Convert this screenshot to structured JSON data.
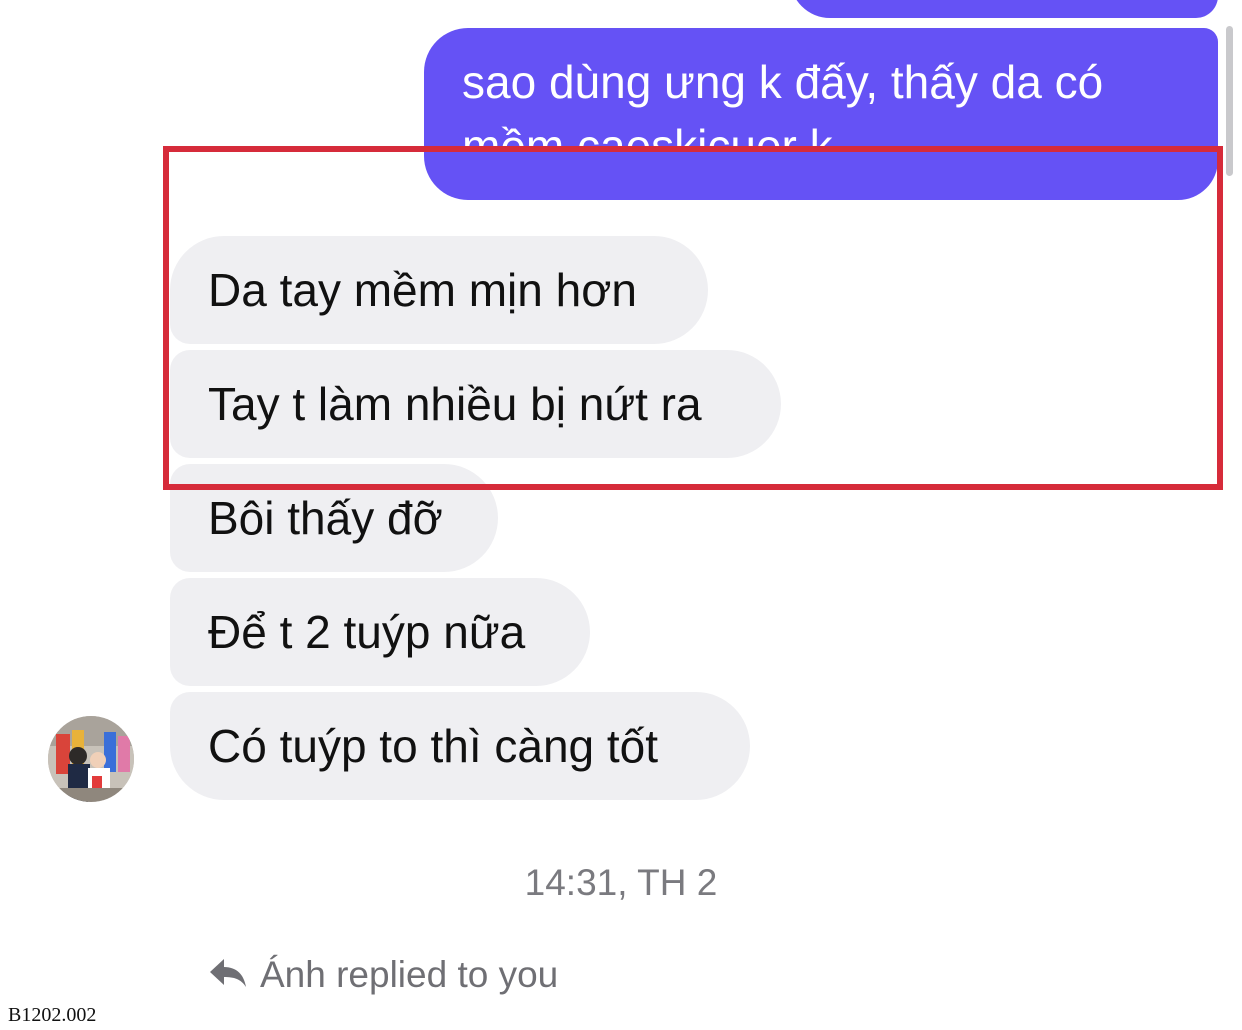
{
  "conversation": {
    "outgoing": {
      "main_line1": "sao dùng ưng k đấy, thấy da có",
      "main_line2": "mềm caeskicuer k"
    },
    "incoming": [
      {
        "text": "Da tay mềm mịn hơn"
      },
      {
        "text": "Tay t làm nhiều bị nứt ra"
      },
      {
        "text": "Bôi thấy đỡ"
      },
      {
        "text": "Để t 2 tuýp nữa"
      },
      {
        "text": "Có tuýp to thì càng tốt"
      }
    ],
    "timestamp": "14:31, TH 2",
    "reply_note": "Ánh replied to you"
  },
  "watermark": "B1202.002",
  "colors": {
    "outgoing_bubble": "#6552f5",
    "incoming_bubble": "#efeff2",
    "highlight_border": "#d62b3a"
  },
  "icons": {
    "reply": "reply-arrow-icon",
    "avatar": "contact-avatar"
  }
}
